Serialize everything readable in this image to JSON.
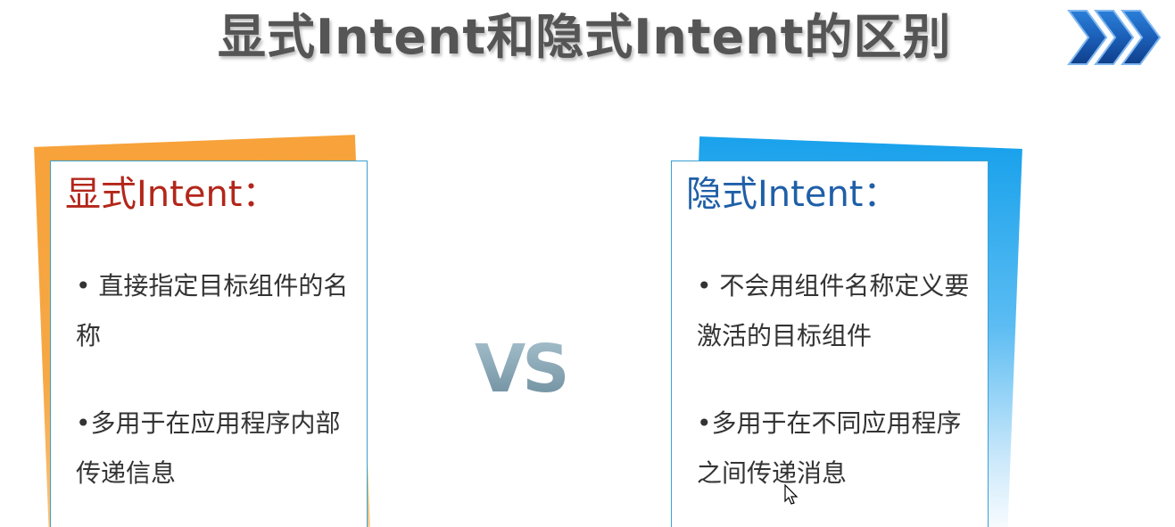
{
  "slide": {
    "title": "显式Intent和隐式Intent的区别",
    "title_icon": "triple-chevron-right-icon",
    "left_card": {
      "heading": "显式Intent：",
      "points": [
        "• 直接指定目标组件的名称",
        "•多用于在应用程序内部传递信息"
      ],
      "accent_color": "#f7a23a",
      "heading_color": "#b3261a"
    },
    "vs_label": "VS",
    "right_card": {
      "heading": "隐式Intent：",
      "points": [
        "• 不会用组件名称定义要激活的目标组件",
        "•多用于在不同应用程序之间传递消息"
      ],
      "accent_color": "#1aa2ec",
      "heading_color": "#1f5fa8"
    },
    "cursor_icon": "mouse-pointer-icon"
  }
}
